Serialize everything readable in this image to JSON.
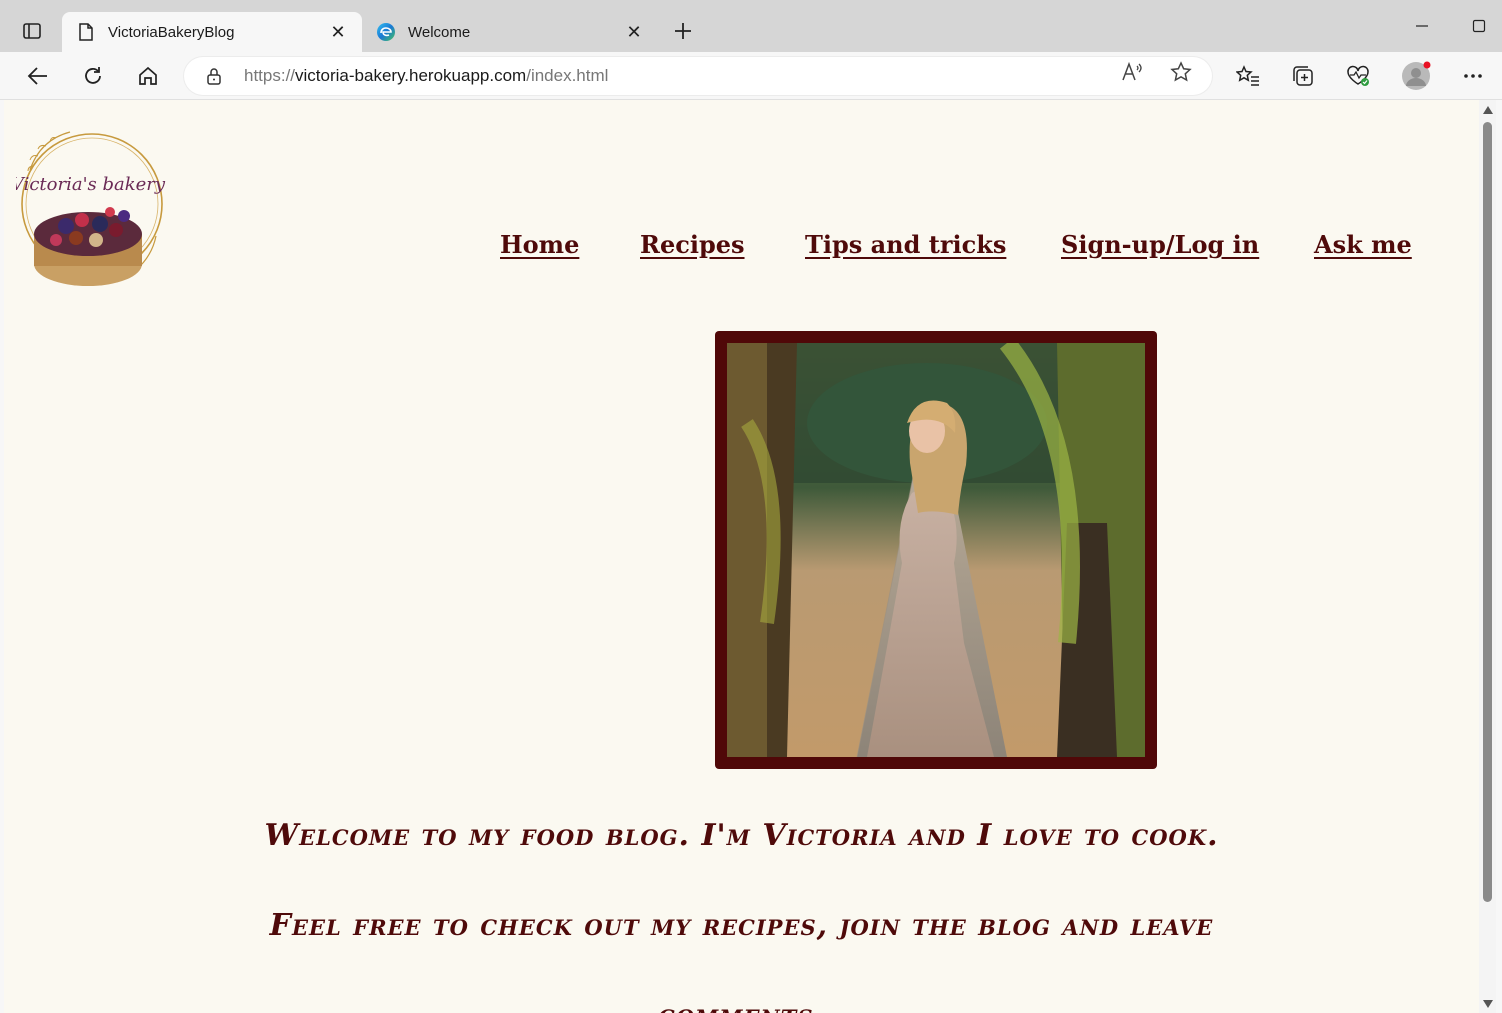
{
  "browser": {
    "tabs": [
      {
        "title": "VictoriaBakeryBlog",
        "icon": "page-icon",
        "active": true
      },
      {
        "title": "Welcome",
        "icon": "edge-icon",
        "active": false
      }
    ],
    "address": {
      "scheme": "https://",
      "host": "victoria-bakery.herokuapp.com",
      "path": "/index.html"
    },
    "accent": "#0f6cbd"
  },
  "site": {
    "logo_text": "Victoria's bakery",
    "nav": [
      "Home",
      "Recipes",
      "Tips and tricks",
      "Sign-up/Log in",
      "Ask me"
    ],
    "intro_line1": "Welcome to my food blog. I'm Victoria and I love to cook.",
    "intro_line2": "Feel free to check out my recipes, join the blog and leave",
    "intro_line3": "comments.",
    "colors": {
      "background": "#fbf9f1",
      "primary": "#4f0a0a"
    }
  }
}
